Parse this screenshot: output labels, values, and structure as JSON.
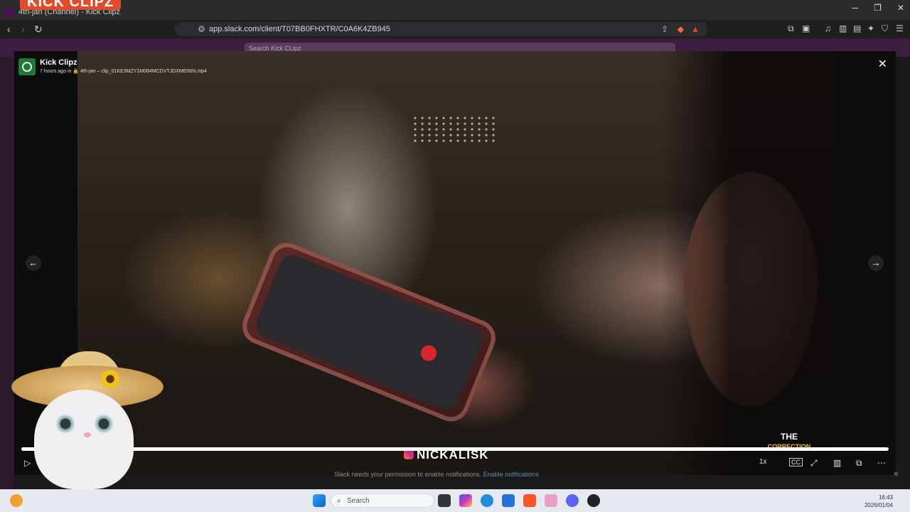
{
  "browser": {
    "tab_title": "4th-jan (Channel) - Kick Clipz",
    "overlay_logo": "KICK CLIPZ",
    "url": "app.slack.com/client/T07BB0FHXTR/C0A6K4ZB945",
    "window_controls": [
      "─",
      "❐",
      "✕"
    ]
  },
  "slack": {
    "search_placeholder": "Search Kick CLipz",
    "notification_text": "Slack needs your permission to enable notifications.",
    "notification_link": "Enable notifications"
  },
  "viewer": {
    "sender_name": "Kick Clipz",
    "time_ago": "7 hours ago in",
    "channel": "4th-jan",
    "filename": "clip_01KE3MZY1M084MCDVTJDXME06N.mp4",
    "speed": "1x",
    "cc": "CC",
    "watermark": "NICKALISK",
    "brand_line1": "THE",
    "brand_line2": "CORRECTION",
    "progress": 0.008
  },
  "taskbar": {
    "search_label": "Search",
    "time": "16:43",
    "date": "2026/01/04"
  },
  "colors": {
    "slack_aubergine": "#3d1d3f",
    "taskbar": "#e6e9ef",
    "accent_link": "#5c8fb8"
  }
}
